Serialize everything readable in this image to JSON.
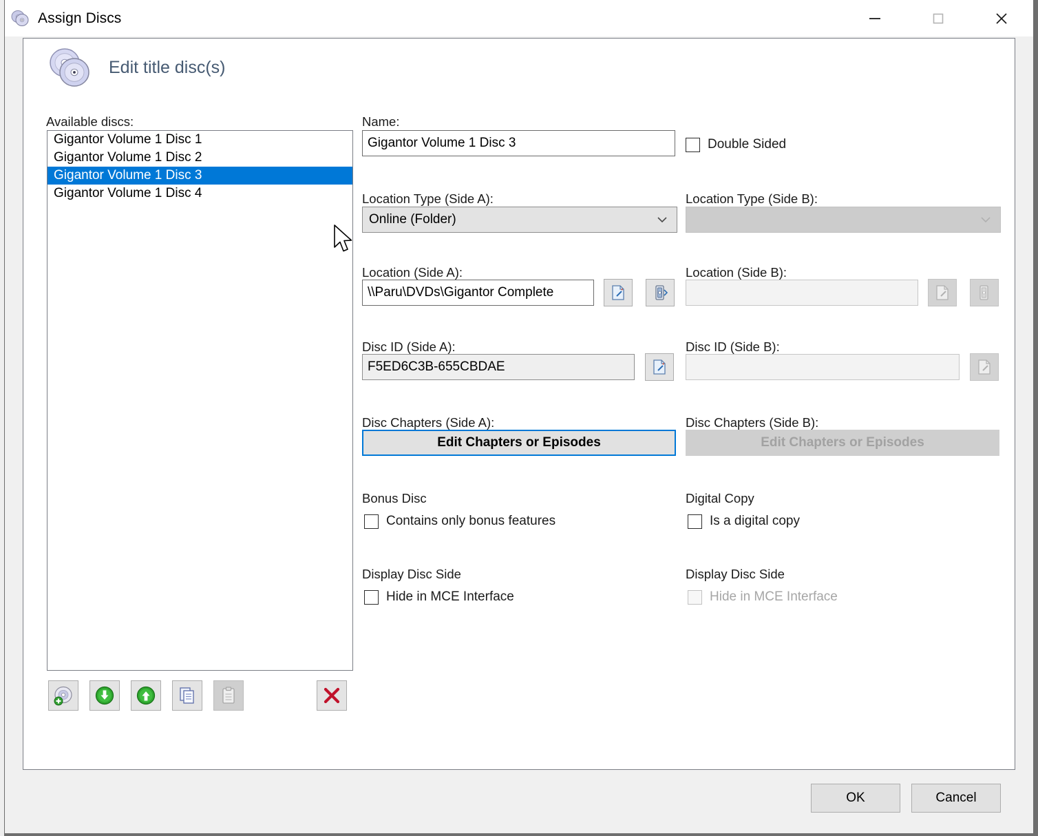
{
  "window": {
    "title": "Assign Discs",
    "icon": "discs-icon",
    "controls": {
      "minimize": "minimize-icon",
      "maximize": "maximize-icon",
      "close": "close-icon"
    }
  },
  "header": {
    "title": "Edit title disc(s)",
    "icon": "two-discs-icon"
  },
  "left": {
    "available_label": "Available discs:",
    "discs": [
      {
        "name": "Gigantor Volume 1 Disc 1",
        "selected": false
      },
      {
        "name": "Gigantor Volume 1 Disc 2",
        "selected": false
      },
      {
        "name": "Gigantor Volume 1 Disc 3",
        "selected": true
      },
      {
        "name": "Gigantor Volume 1 Disc 4",
        "selected": false
      }
    ],
    "toolbar": [
      {
        "name": "add-disc-button",
        "icon": "disc-add-icon",
        "enabled": true
      },
      {
        "name": "move-down-button",
        "icon": "arrow-down-circle-icon",
        "enabled": true
      },
      {
        "name": "move-up-button",
        "icon": "arrow-up-circle-icon",
        "enabled": true
      },
      {
        "name": "copy-button",
        "icon": "copy-pages-icon",
        "enabled": true
      },
      {
        "name": "paste-button",
        "icon": "clipboard-paste-icon",
        "enabled": false
      },
      {
        "name": "delete-button",
        "icon": "red-x-icon",
        "enabled": true
      }
    ]
  },
  "form": {
    "name_label": "Name:",
    "name_value": "Gigantor Volume 1 Disc 3",
    "double_sided_label": "Double Sided",
    "double_sided_checked": false,
    "location_type_a_label": "Location Type (Side A):",
    "location_type_a_value": "Online (Folder)",
    "location_type_b_label": "Location Type (Side B):",
    "location_type_b_value": "",
    "location_a_label": "Location (Side A):",
    "location_a_value": "\\\\Paru\\DVDs\\Gigantor Complete",
    "location_b_label": "Location (Side B):",
    "location_b_value": "",
    "disc_id_a_label": "Disc ID (Side A):",
    "disc_id_a_value": "F5ED6C3B-655CBDAE",
    "disc_id_b_label": "Disc ID (Side B):",
    "disc_id_b_value": "",
    "chapters_a_label": "Disc Chapters (Side A):",
    "chapters_a_button": "Edit Chapters or Episodes",
    "chapters_b_label": "Disc Chapters (Side B):",
    "chapters_b_button": "Edit Chapters or Episodes",
    "bonus_disc_label": "Bonus Disc",
    "bonus_disc_check_label": "Contains only bonus features",
    "bonus_disc_checked": false,
    "digital_copy_label": "Digital Copy",
    "digital_copy_check_label": "Is a digital copy",
    "digital_copy_checked": false,
    "display_side_a_label": "Display Disc Side",
    "hide_mce_a_label": "Hide in MCE Interface",
    "hide_mce_a_checked": false,
    "display_side_b_label": "Display Disc Side",
    "hide_mce_b_label": "Hide in MCE Interface",
    "hide_mce_b_checked": false
  },
  "footer": {
    "ok_label": "OK",
    "cancel_label": "Cancel"
  },
  "colors": {
    "selection": "#0078d7",
    "header_text": "#465a72",
    "focus_border": "#0078d7",
    "delete_x": "#c0122b",
    "green_icon": "#2ca02c"
  }
}
